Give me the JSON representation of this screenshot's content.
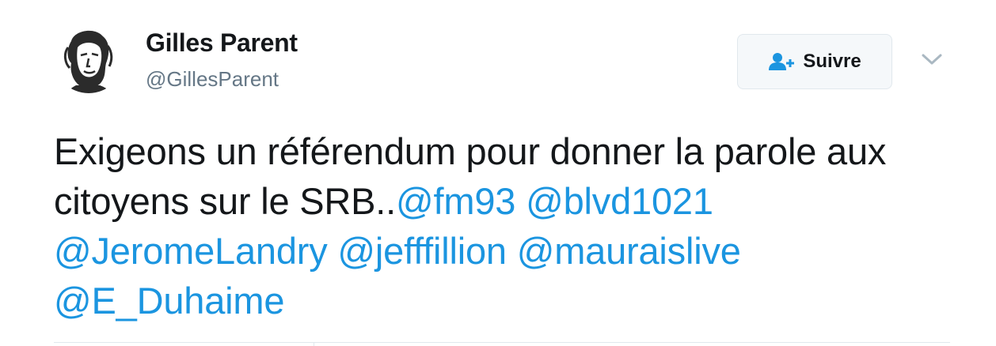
{
  "author": {
    "name": "Gilles Parent",
    "handle": "@GillesParent",
    "avatar_icon": "portrait-sketch-icon"
  },
  "follow_button": {
    "label": "Suivre",
    "icon": "add-user-icon"
  },
  "menu_icon": "chevron-down-icon",
  "tweet": {
    "text_prefix": "Exigeons un référendum pour donner la parole aux citoyens sur le SRB..",
    "mentions": [
      "@fm93",
      "@blvd1021",
      "@JeromeLandry",
      "@jefffillion",
      "@mauraislive",
      "@E_Duhaime"
    ]
  },
  "colors": {
    "text": "#14171a",
    "muted": "#657786",
    "link": "#1b95e0",
    "border": "#e1e8ed"
  }
}
